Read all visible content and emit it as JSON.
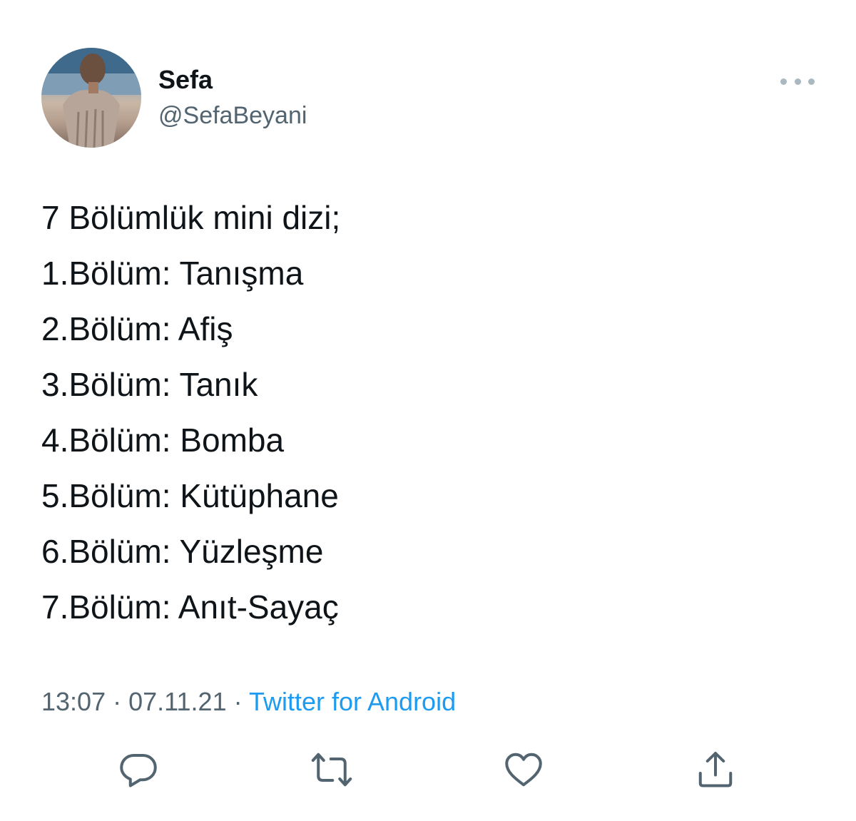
{
  "author": {
    "display_name": "Sefa",
    "handle": "@SefaBeyani"
  },
  "tweet": {
    "lines": [
      "7 Bölümlük mini dizi;",
      "1.Bölüm: Tanışma",
      "2.Bölüm: Afiş",
      "3.Bölüm: Tanık",
      "4.Bölüm: Bomba",
      "5.Bölüm: Kütüphane",
      "6.Bölüm: Yüzleşme",
      "7.Bölüm: Anıt-Sayaç"
    ]
  },
  "meta": {
    "time": "13:07",
    "separator": "·",
    "date": "07.11.21",
    "source": "Twitter for Android"
  },
  "actions": {
    "reply_icon": "reply-icon",
    "retweet_icon": "retweet-icon",
    "like_icon": "heart-icon",
    "share_icon": "share-icon"
  },
  "colors": {
    "text": "#0f1419",
    "secondary": "#536471",
    "link": "#1d9bf0",
    "icon": "#536471"
  }
}
